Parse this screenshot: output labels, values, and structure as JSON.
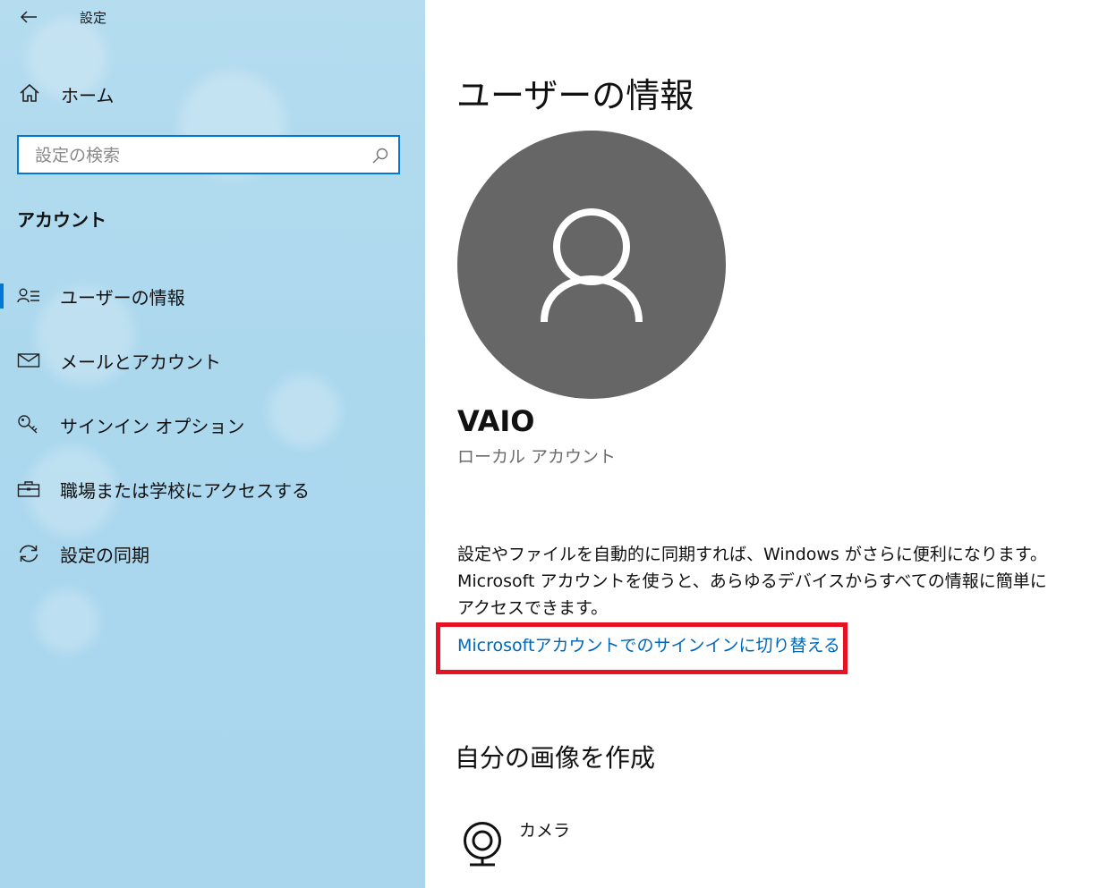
{
  "app": {
    "title": "設定"
  },
  "sidebar": {
    "home_label": "ホーム",
    "search": {
      "placeholder": "設定の検索",
      "value": ""
    },
    "section_title": "アカウント",
    "items": [
      {
        "label": "ユーザーの情報",
        "icon": "person-list-icon",
        "selected": true
      },
      {
        "label": "メールとアカウント",
        "icon": "mail-icon",
        "selected": false
      },
      {
        "label": "サインイン オプション",
        "icon": "key-icon",
        "selected": false
      },
      {
        "label": "職場または学校にアクセスする",
        "icon": "briefcase-icon",
        "selected": false
      },
      {
        "label": "設定の同期",
        "icon": "sync-icon",
        "selected": false
      }
    ]
  },
  "main": {
    "page_title": "ユーザーの情報",
    "user": {
      "name": "VAIO",
      "account_type": "ローカル アカウント"
    },
    "description": "設定やファイルを自動的に同期すれば、Windows がさらに便利になります。Microsoft アカウントを使うと、あらゆるデバイスからすべての情報に簡単にアクセスできます。",
    "switch_link": "Microsoftアカウントでのサインインに切り替える",
    "create_image_heading": "自分の画像を作成",
    "camera_label": "カメラ"
  },
  "colors": {
    "accent": "#0078d7",
    "link": "#0067b8",
    "highlight": "#e81123",
    "avatar_bg": "#666666",
    "sidebar_bg": "#acd8ee"
  }
}
